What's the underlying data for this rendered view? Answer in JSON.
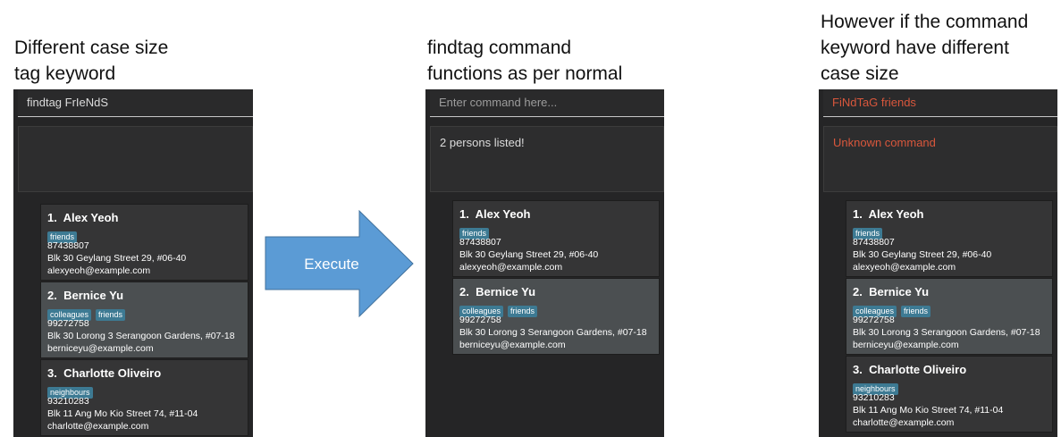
{
  "panels": [
    {
      "caption": [
        "Different case size",
        "tag keyword"
      ],
      "command": {
        "text": "findtag FrIeNdS",
        "style": "normal"
      },
      "result": {
        "text": "",
        "style": "normal"
      },
      "persons": [
        {
          "index": "1.",
          "name": "Alex Yeoh",
          "tags": [
            "friends"
          ],
          "phone": "87438807",
          "address": "Blk 30 Geylang Street 29, #06-40",
          "email": "alexyeoh@example.com",
          "selected": false
        },
        {
          "index": "2.",
          "name": "Bernice Yu",
          "tags": [
            "colleagues",
            "friends"
          ],
          "phone": "99272758",
          "address": "Blk 30 Lorong 3 Serangoon Gardens, #07-18",
          "email": "berniceyu@example.com",
          "selected": true
        },
        {
          "index": "3.",
          "name": "Charlotte Oliveiro",
          "tags": [
            "neighbours"
          ],
          "phone": "93210283",
          "address": "Blk 11 Ang Mo Kio Street 74, #11-04",
          "email": "charlotte@example.com",
          "selected": false
        }
      ]
    },
    {
      "caption": [
        "findtag command",
        "functions as per normal"
      ],
      "command": {
        "text": "Enter command here...",
        "style": "placeholder"
      },
      "result": {
        "text": "2 persons listed!",
        "style": "normal"
      },
      "persons": [
        {
          "index": "1.",
          "name": "Alex Yeoh",
          "tags": [
            "friends"
          ],
          "phone": "87438807",
          "address": "Blk 30 Geylang Street 29, #06-40",
          "email": "alexyeoh@example.com",
          "selected": false
        },
        {
          "index": "2.",
          "name": "Bernice Yu",
          "tags": [
            "colleagues",
            "friends"
          ],
          "phone": "99272758",
          "address": "Blk 30 Lorong 3 Serangoon Gardens, #07-18",
          "email": "berniceyu@example.com",
          "selected": true
        }
      ]
    },
    {
      "caption": [
        "However if the command",
        "keyword have different",
        "case size"
      ],
      "command": {
        "text": "FiNdTaG friends",
        "style": "error"
      },
      "result": {
        "text": "Unknown command",
        "style": "error"
      },
      "persons": [
        {
          "index": "1.",
          "name": "Alex Yeoh",
          "tags": [
            "friends"
          ],
          "phone": "87438807",
          "address": "Blk 30 Geylang Street 29, #06-40",
          "email": "alexyeoh@example.com",
          "selected": false
        },
        {
          "index": "2.",
          "name": "Bernice Yu",
          "tags": [
            "colleagues",
            "friends"
          ],
          "phone": "99272758",
          "address": "Blk 30 Lorong 3 Serangoon Gardens, #07-18",
          "email": "berniceyu@example.com",
          "selected": true
        },
        {
          "index": "3.",
          "name": "Charlotte Oliveiro",
          "tags": [
            "neighbours"
          ],
          "phone": "93210283",
          "address": "Blk 11 Ang Mo Kio Street 74, #11-04",
          "email": "charlotte@example.com",
          "selected": false
        }
      ]
    }
  ],
  "arrow": {
    "label": "Execute",
    "icon": "right-arrow-icon",
    "color": "#5b9bd5"
  },
  "colors": {
    "window_bg": "#252526",
    "card_bg": "#353536",
    "card_selected_bg": "#4b4f51",
    "tag_bg": "#3d7a93",
    "error_text": "#d9573c"
  }
}
